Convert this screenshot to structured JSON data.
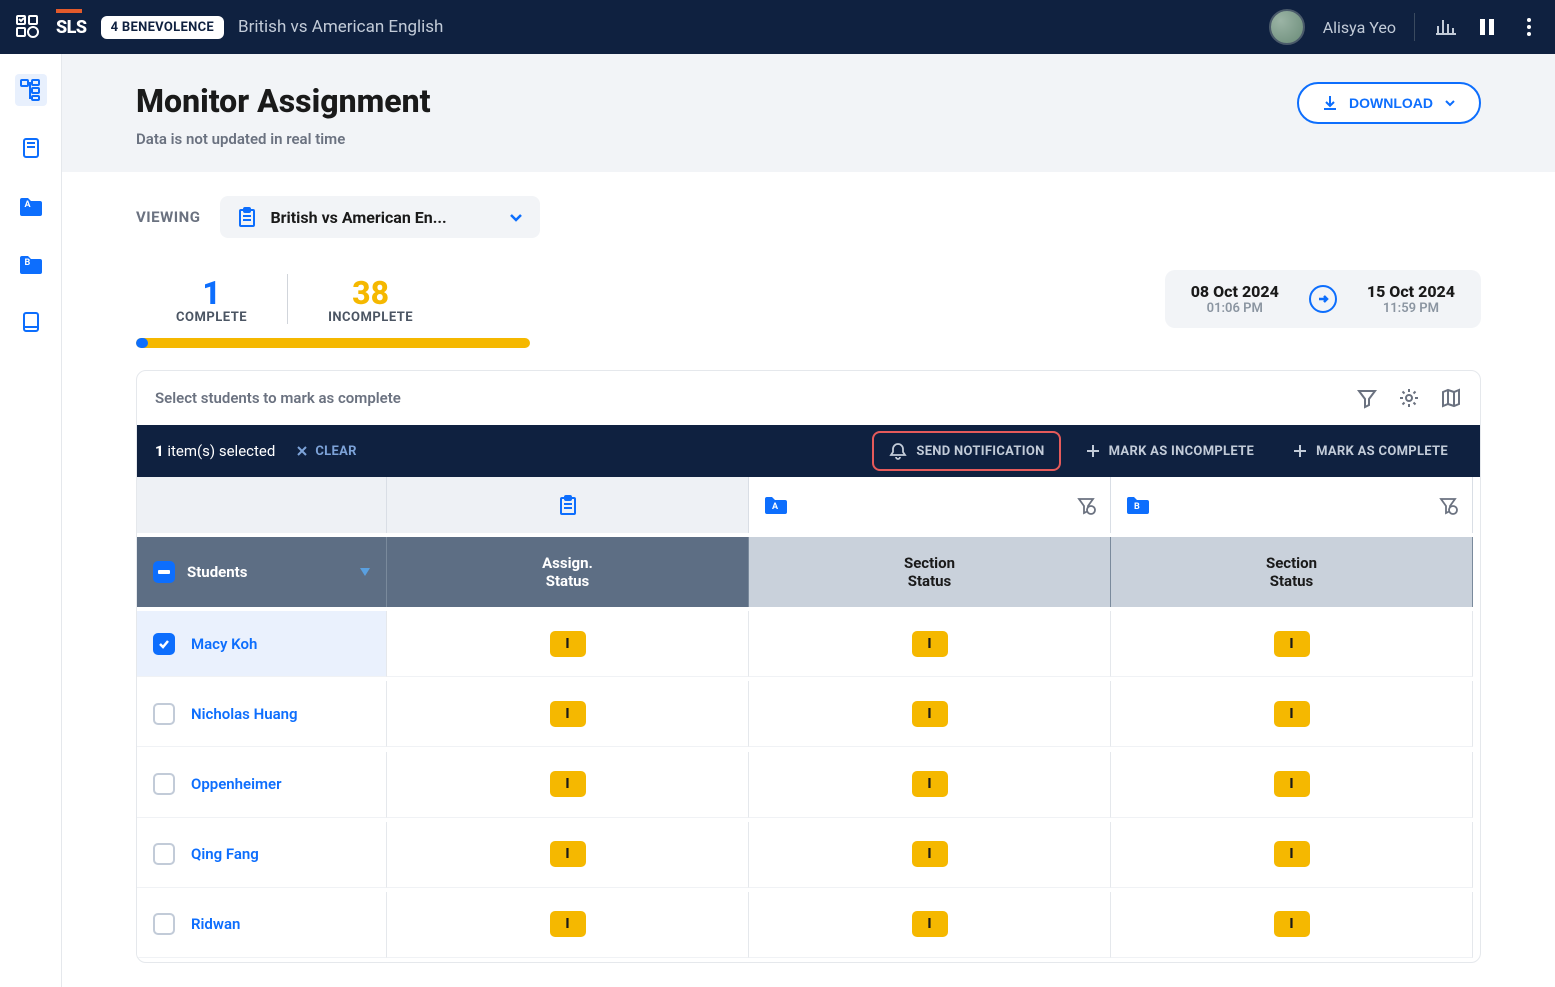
{
  "topbar": {
    "class_badge": "4 BENEVOLENCE",
    "subtitle": "British vs American English",
    "username": "Alisya Yeo"
  },
  "hero": {
    "title": "Monitor Assignment",
    "subtitle": "Data is not updated in real time",
    "download_label": "DOWNLOAD"
  },
  "viewing": {
    "label": "VIEWING",
    "value": "British vs American En..."
  },
  "stats": {
    "complete_count": "1",
    "complete_label": "COMPLETE",
    "incomplete_count": "38",
    "incomplete_label": "INCOMPLETE",
    "progress_pct": 3
  },
  "dates": {
    "start_date": "08 Oct 2024",
    "start_time": "01:06 PM",
    "end_date": "15 Oct 2024",
    "end_time": "11:59 PM"
  },
  "table": {
    "hint": "Select students to mark as complete",
    "selected_count": "1",
    "selected_suffix": " item(s) selected",
    "clear_label": "CLEAR",
    "send_notif_label": "SEND NOTIFICATION",
    "mark_incomplete_label": "MARK AS INCOMPLETE",
    "mark_complete_label": "MARK AS COMPLETE",
    "col_students": "Students",
    "col_assign_1": "Assign.",
    "col_assign_2": "Status",
    "col_section_1": "Section",
    "col_section_2": "Status",
    "section_a": "A",
    "section_b": "B",
    "status_badge": "I",
    "rows": [
      {
        "name": "Macy Koh",
        "selected": true
      },
      {
        "name": "Nicholas Huang",
        "selected": false
      },
      {
        "name": "Oppenheimer",
        "selected": false
      },
      {
        "name": "Qing Fang",
        "selected": false
      },
      {
        "name": "Ridwan",
        "selected": false
      }
    ]
  }
}
